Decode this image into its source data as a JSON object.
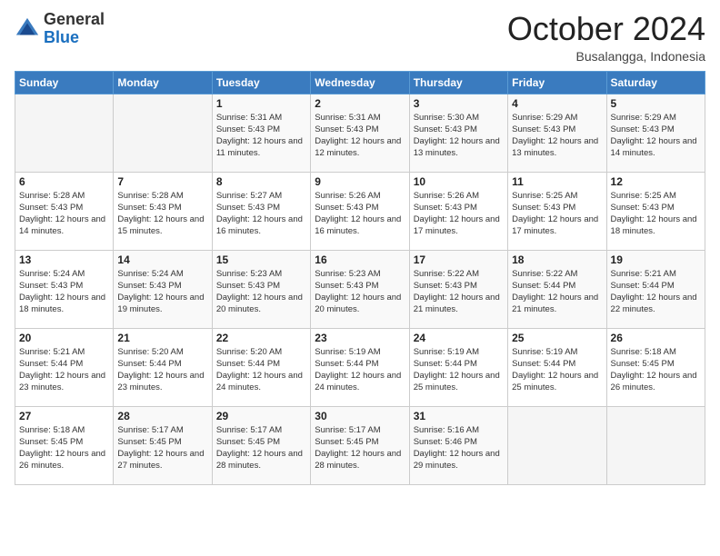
{
  "logo": {
    "general": "General",
    "blue": "Blue"
  },
  "header": {
    "month": "October 2024",
    "location": "Busalangga, Indonesia"
  },
  "weekdays": [
    "Sunday",
    "Monday",
    "Tuesday",
    "Wednesday",
    "Thursday",
    "Friday",
    "Saturday"
  ],
  "weeks": [
    [
      {
        "day": "",
        "sunrise": "",
        "sunset": "",
        "daylight": ""
      },
      {
        "day": "",
        "sunrise": "",
        "sunset": "",
        "daylight": ""
      },
      {
        "day": "1",
        "sunrise": "Sunrise: 5:31 AM",
        "sunset": "Sunset: 5:43 PM",
        "daylight": "Daylight: 12 hours and 11 minutes."
      },
      {
        "day": "2",
        "sunrise": "Sunrise: 5:31 AM",
        "sunset": "Sunset: 5:43 PM",
        "daylight": "Daylight: 12 hours and 12 minutes."
      },
      {
        "day": "3",
        "sunrise": "Sunrise: 5:30 AM",
        "sunset": "Sunset: 5:43 PM",
        "daylight": "Daylight: 12 hours and 13 minutes."
      },
      {
        "day": "4",
        "sunrise": "Sunrise: 5:29 AM",
        "sunset": "Sunset: 5:43 PM",
        "daylight": "Daylight: 12 hours and 13 minutes."
      },
      {
        "day": "5",
        "sunrise": "Sunrise: 5:29 AM",
        "sunset": "Sunset: 5:43 PM",
        "daylight": "Daylight: 12 hours and 14 minutes."
      }
    ],
    [
      {
        "day": "6",
        "sunrise": "Sunrise: 5:28 AM",
        "sunset": "Sunset: 5:43 PM",
        "daylight": "Daylight: 12 hours and 14 minutes."
      },
      {
        "day": "7",
        "sunrise": "Sunrise: 5:28 AM",
        "sunset": "Sunset: 5:43 PM",
        "daylight": "Daylight: 12 hours and 15 minutes."
      },
      {
        "day": "8",
        "sunrise": "Sunrise: 5:27 AM",
        "sunset": "Sunset: 5:43 PM",
        "daylight": "Daylight: 12 hours and 16 minutes."
      },
      {
        "day": "9",
        "sunrise": "Sunrise: 5:26 AM",
        "sunset": "Sunset: 5:43 PM",
        "daylight": "Daylight: 12 hours and 16 minutes."
      },
      {
        "day": "10",
        "sunrise": "Sunrise: 5:26 AM",
        "sunset": "Sunset: 5:43 PM",
        "daylight": "Daylight: 12 hours and 17 minutes."
      },
      {
        "day": "11",
        "sunrise": "Sunrise: 5:25 AM",
        "sunset": "Sunset: 5:43 PM",
        "daylight": "Daylight: 12 hours and 17 minutes."
      },
      {
        "day": "12",
        "sunrise": "Sunrise: 5:25 AM",
        "sunset": "Sunset: 5:43 PM",
        "daylight": "Daylight: 12 hours and 18 minutes."
      }
    ],
    [
      {
        "day": "13",
        "sunrise": "Sunrise: 5:24 AM",
        "sunset": "Sunset: 5:43 PM",
        "daylight": "Daylight: 12 hours and 18 minutes."
      },
      {
        "day": "14",
        "sunrise": "Sunrise: 5:24 AM",
        "sunset": "Sunset: 5:43 PM",
        "daylight": "Daylight: 12 hours and 19 minutes."
      },
      {
        "day": "15",
        "sunrise": "Sunrise: 5:23 AM",
        "sunset": "Sunset: 5:43 PM",
        "daylight": "Daylight: 12 hours and 20 minutes."
      },
      {
        "day": "16",
        "sunrise": "Sunrise: 5:23 AM",
        "sunset": "Sunset: 5:43 PM",
        "daylight": "Daylight: 12 hours and 20 minutes."
      },
      {
        "day": "17",
        "sunrise": "Sunrise: 5:22 AM",
        "sunset": "Sunset: 5:43 PM",
        "daylight": "Daylight: 12 hours and 21 minutes."
      },
      {
        "day": "18",
        "sunrise": "Sunrise: 5:22 AM",
        "sunset": "Sunset: 5:44 PM",
        "daylight": "Daylight: 12 hours and 21 minutes."
      },
      {
        "day": "19",
        "sunrise": "Sunrise: 5:21 AM",
        "sunset": "Sunset: 5:44 PM",
        "daylight": "Daylight: 12 hours and 22 minutes."
      }
    ],
    [
      {
        "day": "20",
        "sunrise": "Sunrise: 5:21 AM",
        "sunset": "Sunset: 5:44 PM",
        "daylight": "Daylight: 12 hours and 23 minutes."
      },
      {
        "day": "21",
        "sunrise": "Sunrise: 5:20 AM",
        "sunset": "Sunset: 5:44 PM",
        "daylight": "Daylight: 12 hours and 23 minutes."
      },
      {
        "day": "22",
        "sunrise": "Sunrise: 5:20 AM",
        "sunset": "Sunset: 5:44 PM",
        "daylight": "Daylight: 12 hours and 24 minutes."
      },
      {
        "day": "23",
        "sunrise": "Sunrise: 5:19 AM",
        "sunset": "Sunset: 5:44 PM",
        "daylight": "Daylight: 12 hours and 24 minutes."
      },
      {
        "day": "24",
        "sunrise": "Sunrise: 5:19 AM",
        "sunset": "Sunset: 5:44 PM",
        "daylight": "Daylight: 12 hours and 25 minutes."
      },
      {
        "day": "25",
        "sunrise": "Sunrise: 5:19 AM",
        "sunset": "Sunset: 5:44 PM",
        "daylight": "Daylight: 12 hours and 25 minutes."
      },
      {
        "day": "26",
        "sunrise": "Sunrise: 5:18 AM",
        "sunset": "Sunset: 5:45 PM",
        "daylight": "Daylight: 12 hours and 26 minutes."
      }
    ],
    [
      {
        "day": "27",
        "sunrise": "Sunrise: 5:18 AM",
        "sunset": "Sunset: 5:45 PM",
        "daylight": "Daylight: 12 hours and 26 minutes."
      },
      {
        "day": "28",
        "sunrise": "Sunrise: 5:17 AM",
        "sunset": "Sunset: 5:45 PM",
        "daylight": "Daylight: 12 hours and 27 minutes."
      },
      {
        "day": "29",
        "sunrise": "Sunrise: 5:17 AM",
        "sunset": "Sunset: 5:45 PM",
        "daylight": "Daylight: 12 hours and 28 minutes."
      },
      {
        "day": "30",
        "sunrise": "Sunrise: 5:17 AM",
        "sunset": "Sunset: 5:45 PM",
        "daylight": "Daylight: 12 hours and 28 minutes."
      },
      {
        "day": "31",
        "sunrise": "Sunrise: 5:16 AM",
        "sunset": "Sunset: 5:46 PM",
        "daylight": "Daylight: 12 hours and 29 minutes."
      },
      {
        "day": "",
        "sunrise": "",
        "sunset": "",
        "daylight": ""
      },
      {
        "day": "",
        "sunrise": "",
        "sunset": "",
        "daylight": ""
      }
    ]
  ]
}
